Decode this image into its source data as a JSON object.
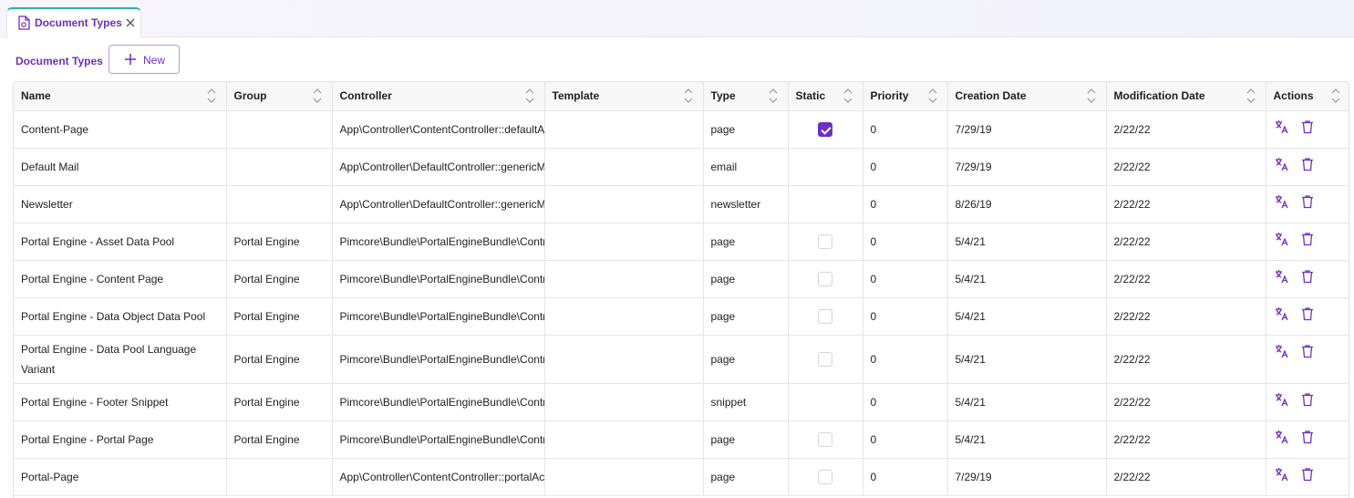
{
  "tab": {
    "label": "Document Types",
    "icon": "document-settings-icon",
    "close_icon": "close-icon"
  },
  "toolbar": {
    "title": "Document Types",
    "new_label": "New"
  },
  "columns": [
    "Name",
    "Group",
    "Controller",
    "Template",
    "Type",
    "Static",
    "Priority",
    "Creation Date",
    "Modification Date",
    "Actions"
  ],
  "rows": [
    {
      "name": "Content-Page",
      "group": "",
      "controller": "App\\Controller\\ContentController::defaultAction",
      "template": "",
      "type": "page",
      "static": "checked",
      "priority": "0",
      "created": "7/29/19",
      "modified": "2/22/22"
    },
    {
      "name": "Default Mail",
      "group": "",
      "controller": "App\\Controller\\DefaultController::genericMailAction",
      "template": "",
      "type": "email",
      "static": "none",
      "priority": "0",
      "created": "7/29/19",
      "modified": "2/22/22"
    },
    {
      "name": "Newsletter",
      "group": "",
      "controller": "App\\Controller\\DefaultController::genericMailAction",
      "template": "",
      "type": "newsletter",
      "static": "none",
      "priority": "0",
      "created": "8/26/19",
      "modified": "2/22/22"
    },
    {
      "name": "Portal Engine - Asset Data Pool",
      "group": "Portal Engine",
      "controller": "Pimcore\\Bundle\\PortalEngineBundle\\Controller",
      "template": "",
      "type": "page",
      "static": "unchecked",
      "priority": "0",
      "created": "5/4/21",
      "modified": "2/22/22"
    },
    {
      "name": "Portal Engine - Content Page",
      "group": "Portal Engine",
      "controller": "Pimcore\\Bundle\\PortalEngineBundle\\Controller",
      "template": "",
      "type": "page",
      "static": "unchecked",
      "priority": "0",
      "created": "5/4/21",
      "modified": "2/22/22"
    },
    {
      "name": "Portal Engine - Data Object Data Pool",
      "group": "Portal Engine",
      "controller": "Pimcore\\Bundle\\PortalEngineBundle\\Controller",
      "template": "",
      "type": "page",
      "static": "unchecked",
      "priority": "0",
      "created": "5/4/21",
      "modified": "2/22/22"
    },
    {
      "name": "Portal Engine - Data Pool Language Variant",
      "group": "Portal Engine",
      "controller": "Pimcore\\Bundle\\PortalEngineBundle\\Controller",
      "template": "",
      "type": "page",
      "static": "unchecked",
      "priority": "0",
      "created": "5/4/21",
      "modified": "2/22/22"
    },
    {
      "name": "Portal Engine - Footer Snippet",
      "group": "Portal Engine",
      "controller": "Pimcore\\Bundle\\PortalEngineBundle\\Controller",
      "template": "",
      "type": "snippet",
      "static": "none",
      "priority": "0",
      "created": "5/4/21",
      "modified": "2/22/22"
    },
    {
      "name": "Portal Engine - Portal Page",
      "group": "Portal Engine",
      "controller": "Pimcore\\Bundle\\PortalEngineBundle\\Controller",
      "template": "",
      "type": "page",
      "static": "unchecked",
      "priority": "0",
      "created": "5/4/21",
      "modified": "2/22/22"
    },
    {
      "name": "Portal-Page",
      "group": "",
      "controller": "App\\Controller\\ContentController::portalAction",
      "template": "",
      "type": "page",
      "static": "unchecked",
      "priority": "0",
      "created": "7/29/19",
      "modified": "2/22/22"
    }
  ],
  "icons": {
    "translate": "translate-icon",
    "delete": "trash-icon",
    "sort": "sort-icon"
  },
  "colors": {
    "accent": "#6e2fc2",
    "tab_border": "#2fb3a6"
  }
}
